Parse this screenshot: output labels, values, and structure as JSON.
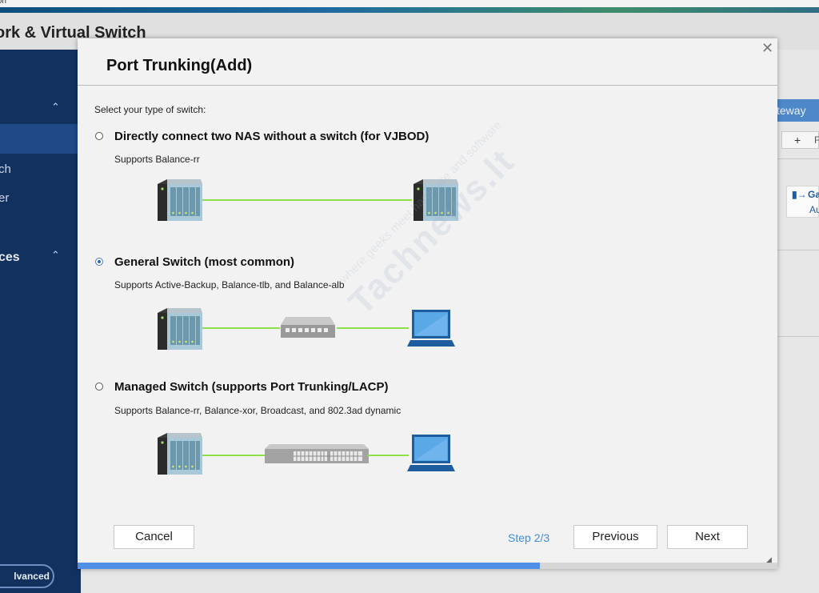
{
  "browser": {
    "tab_fragment": "ton"
  },
  "app": {
    "title": "ork & Virtual Switch",
    "sidebar": {
      "items": [
        {
          "label": "ch"
        },
        {
          "label": "er"
        }
      ],
      "section2": "ces",
      "advanced_label": "lvanced"
    },
    "background": {
      "gateway_tab": "teway",
      "add_button_plus": "+",
      "add_button_text": "F",
      "gateway_card_prefix": "Ga",
      "gateway_card_sub": "Au"
    }
  },
  "dialog": {
    "title": "Port Trunking(Add)",
    "prompt": "Select your type of switch:",
    "options": [
      {
        "label": "Directly connect two NAS without a switch (for VJBOD)",
        "desc": "Supports Balance-rr",
        "selected": false
      },
      {
        "label": "General Switch (most common)",
        "desc": "Supports Active-Backup, Balance-tlb, and Balance-alb",
        "selected": true
      },
      {
        "label": "Managed Switch (supports Port Trunking/LACP)",
        "desc": "Supports Balance-rr, Balance-xor, Broadcast, and 802.3ad dynamic",
        "selected": false
      }
    ],
    "buttons": {
      "cancel": "Cancel",
      "previous": "Previous",
      "next": "Next"
    },
    "step": "Step 2/3",
    "progress": 0.66,
    "colors": {
      "link_line": "#8ee04a",
      "progress": "#4f90e6",
      "step_text": "#3f8ee0"
    }
  },
  "watermark": {
    "brand": "Tachnews.lt",
    "tagline": "where geeks meet hardware and software"
  }
}
